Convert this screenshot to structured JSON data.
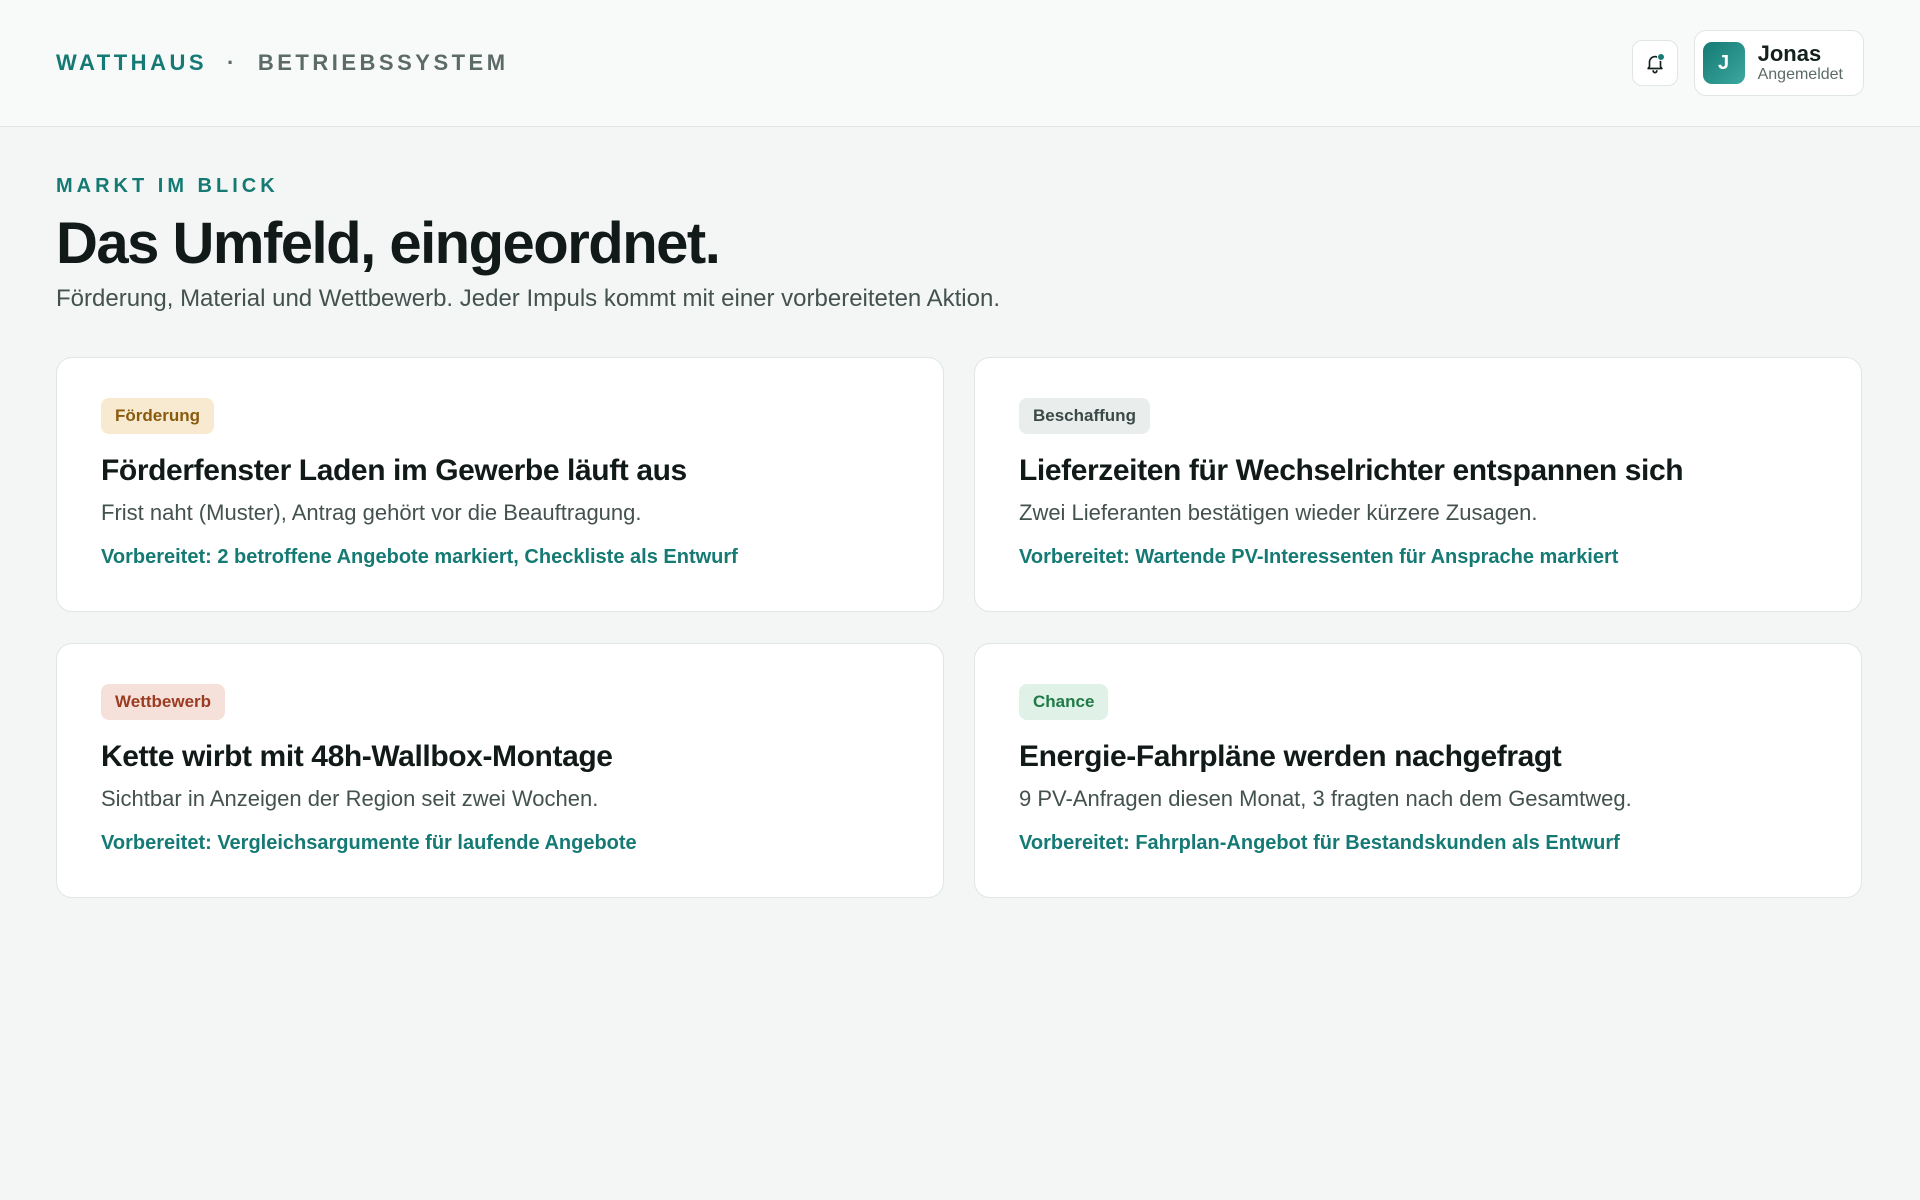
{
  "header": {
    "brand": "WATTHAUS",
    "separator": "·",
    "product": "BETRIEBSSYSTEM",
    "user": {
      "initial": "J",
      "name": "Jonas",
      "status": "Angemeldet"
    },
    "notification_icon": "bell-icon"
  },
  "main": {
    "eyebrow": "MARKT IM BLICK",
    "title": "Das Umfeld, eingeordnet.",
    "subtitle": "Förderung, Material und Wettbewerb. Jeder Impuls kommt mit einer vorbereiteten Aktion."
  },
  "cards": [
    {
      "tag": "Förderung",
      "tag_bg": "#f7ead0",
      "tag_fg": "#8a5a0e",
      "title": "Förderfenster Laden im Gewerbe läuft aus",
      "description": "Frist naht (Muster), Antrag gehört vor die Beauftragung.",
      "action": "Vorbereitet: 2 betroffene Angebote markiert, Checkliste als Entwurf"
    },
    {
      "tag": "Beschaffung",
      "tag_bg": "#e9eeed",
      "tag_fg": "#3b4a47",
      "title": "Lieferzeiten für Wechselrichter entspannen sich",
      "description": "Zwei Lieferanten bestätigen wieder kürzere Zusagen.",
      "action": "Vorbereitet: Wartende PV-Interessenten für Ansprache markiert"
    },
    {
      "tag": "Wettbewerb",
      "tag_bg": "#f6e1da",
      "tag_fg": "#9a3b22",
      "title": "Kette wirbt mit 48h-Wallbox-Montage",
      "description": "Sichtbar in Anzeigen der Region seit zwei Wochen.",
      "action": "Vorbereitet: Vergleichsargumente für laufende Angebote"
    },
    {
      "tag": "Chance",
      "tag_bg": "#e0f1e7",
      "tag_fg": "#1f7a46",
      "title": "Energie-Fahrpläne werden nachgefragt",
      "description": "9 PV-Anfragen diesen Monat, 3 fragten nach dem Gesamtweg.",
      "action": "Vorbereitet: Fahrplan-Angebot für Bestandskunden als Entwurf"
    }
  ]
}
